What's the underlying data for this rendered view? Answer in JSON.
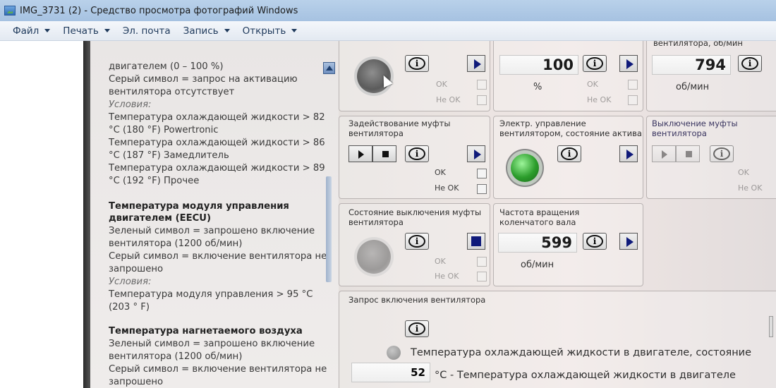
{
  "window": {
    "title": "IMG_3731 (2) - Средство просмотра фотографий Windows"
  },
  "menu": [
    {
      "label": "Файл"
    },
    {
      "label": "Печать"
    },
    {
      "label": "Эл. почта"
    },
    {
      "label": "Запись"
    },
    {
      "label": "Открыть"
    }
  ],
  "help": {
    "lines": [
      "двигателем (0 – 100 %)",
      "Серый символ = запрос на активацию",
      "вентилятора отсутствует",
      "Условия:",
      "Температура охлаждающей жидкости > 82",
      "°C (180 °F) Powertronic",
      "Температура охлаждающей жидкости > 86",
      "°C (187 °F) Замедлитель",
      "Температура охлаждающей жидкости > 89",
      "°C (192 °F) Прочее",
      "Температура модуля управления",
      "двигателем (EECU)",
      "Зеленый символ = запрошено включение",
      "вентилятора (1200 об/мин)",
      "Серый символ = включение вентилятора не",
      "запрошено",
      "Условия:",
      "Температура модуля управления > 95 °C",
      "(203 ° F)",
      "Температура нагнетаемого воздуха",
      "Зеленый символ = запрошено включение",
      "вентилятора (1200 об/мин)",
      "Серый символ = включение вентилятора не",
      "запрошено"
    ]
  },
  "panel": {
    "top_row": {
      "fan_speed_header": "вентилятора, об/мин",
      "value_left": "100",
      "unit_left": "%",
      "value_right": "794",
      "unit_right": "об/мин"
    },
    "ok": "OK",
    "not_ok": "Не OK",
    "clutch_engage": {
      "title": "Задействование муфты вентилятора"
    },
    "electric_control": {
      "title": "Электр. управление вентилятором, состояние актива"
    },
    "clutch_off": {
      "title": "Выключение муфты вентилятора"
    },
    "clutch_off_state": {
      "title": "Состояние выключения муфты вентилятора"
    },
    "crank_speed": {
      "title": "Частота вращения коленчатого вала",
      "value": "599",
      "unit": "об/мин"
    },
    "fan_request": {
      "title": "Запрос включения вентилятора",
      "coolant_state": "Температура охлаждающей жидкости в двигателе, состояние",
      "coolant_value": "52",
      "coolant_label": "°C - Температура охлаждающей жидкости в двигателе"
    }
  }
}
